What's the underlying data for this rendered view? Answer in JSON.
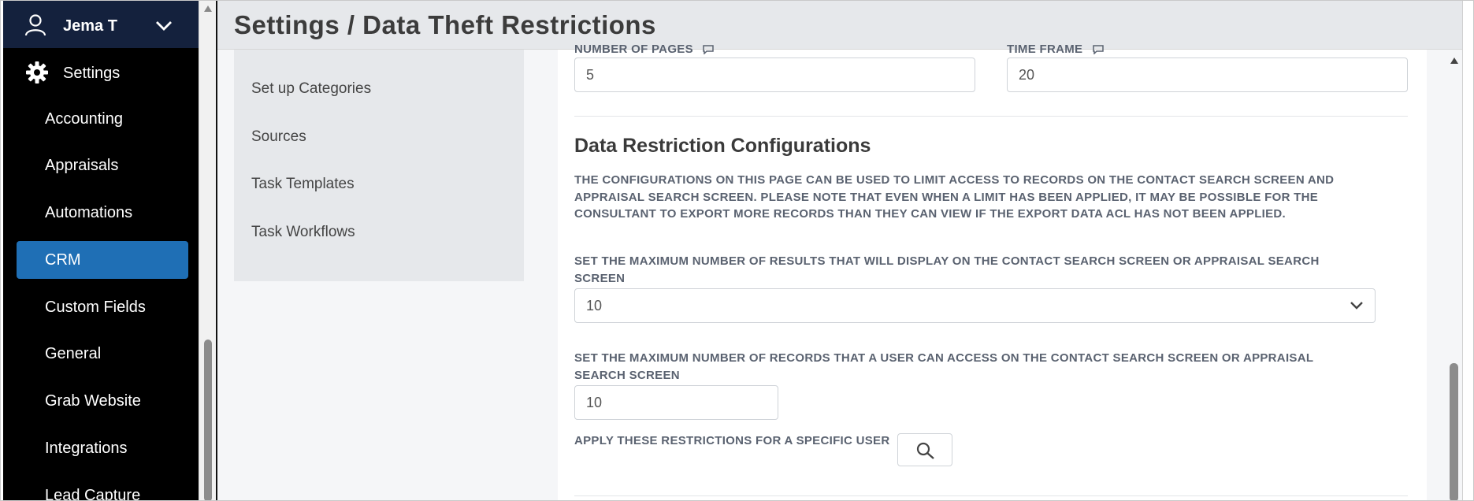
{
  "header": {
    "title": "Settings / Data Theft Restrictions"
  },
  "sidebar": {
    "user_name": "Jema T",
    "settings_label": "Settings",
    "items": [
      {
        "label": "Accounting"
      },
      {
        "label": "Appraisals"
      },
      {
        "label": "Automations"
      },
      {
        "label": "CRM",
        "active": true
      },
      {
        "label": "Custom Fields"
      },
      {
        "label": "General"
      },
      {
        "label": "Grab Website"
      },
      {
        "label": "Integrations"
      },
      {
        "label": "Lead Capture"
      }
    ]
  },
  "subnav": {
    "items": [
      {
        "label": "Set up Categories"
      },
      {
        "label": "Sources"
      },
      {
        "label": "Task Templates"
      },
      {
        "label": "Task Workflows"
      }
    ]
  },
  "form": {
    "number_of_pages_label": "NUMBER OF PAGES",
    "number_of_pages_value": "5",
    "time_frame_label": "TIME FRAME",
    "time_frame_value": "20",
    "section_title": "Data Restriction Configurations",
    "description": "THE CONFIGURATIONS ON THIS PAGE CAN BE USED TO LIMIT ACCESS TO RECORDS ON THE CONTACT SEARCH SCREEN AND APPRAISAL SEARCH SCREEN. PLEASE NOTE THAT EVEN WHEN A LIMIT HAS BEEN APPLIED, IT MAY BE POSSIBLE FOR THE CONSULTANT TO EXPORT MORE RECORDS THAN THEY CAN VIEW IF THE EXPORT DATA ACL HAS NOT BEEN APPLIED.",
    "max_results_label": "SET THE MAXIMUM NUMBER OF RESULTS THAT WILL DISPLAY ON THE CONTACT SEARCH SCREEN OR APPRAISAL SEARCH SCREEN",
    "max_results_value": "10",
    "max_records_label": "SET THE MAXIMUM NUMBER OF RECORDS THAT A USER CAN ACCESS ON THE CONTACT SEARCH SCREEN OR APPRAISAL SEARCH SCREEN",
    "max_records_value": "10",
    "specific_user_label": "APPLY THESE RESTRICTIONS FOR A SPECIFIC USER"
  },
  "colors": {
    "sidebar_bg": "#000000",
    "user_row_bg": "#14213d",
    "active_item": "#1f6fb5",
    "header_bg": "#e6e8eb",
    "label_text": "#5a6270"
  },
  "icons": {
    "user": "user-icon",
    "settings": "gear-icon",
    "dropdown": "chevron-down-icon",
    "comment": "comment-icon",
    "search": "search-icon"
  }
}
